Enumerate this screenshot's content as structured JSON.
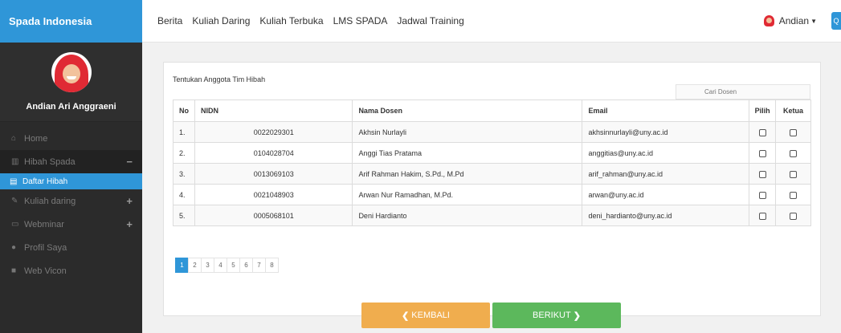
{
  "sidebar": {
    "brand": "Spada Indonesia",
    "profile_name": "Andian Ari Anggraeni",
    "items": [
      {
        "label": "Home",
        "icon": "home-icon"
      },
      {
        "label": "Hibah Spada",
        "icon": "book-icon",
        "toggle": "−"
      },
      {
        "label": "Daftar Hibah",
        "icon": "document-icon"
      },
      {
        "label": "Kuliah daring",
        "icon": "edit-icon",
        "toggle": "+"
      },
      {
        "label": "Webminar",
        "icon": "monitor-icon",
        "toggle": "+"
      },
      {
        "label": "Profil Saya",
        "icon": "user-icon"
      },
      {
        "label": "Web Vicon",
        "icon": "video-icon"
      }
    ]
  },
  "topbar": {
    "nav": [
      "Berita",
      "Kuliah Daring",
      "Kuliah Terbuka",
      "LMS SPADA",
      "Jadwal Training"
    ],
    "user_name": "Andian"
  },
  "panel": {
    "title": "Tentukan Anggota Tim Hibah",
    "search_placeholder": "Cari Dosen"
  },
  "table": {
    "headers": {
      "no": "No",
      "nidn": "NIDN",
      "nama": "Nama Dosen",
      "email": "Email",
      "pilih": "Pilih",
      "ketua": "Ketua"
    },
    "rows": [
      {
        "no": "1.",
        "nidn": "0022029301",
        "nama": "Akhsin Nurlayli",
        "email": "akhsinnurlayli@uny.ac.id"
      },
      {
        "no": "2.",
        "nidn": "0104028704",
        "nama": "Anggi Tias Pratama",
        "email": "anggitias@uny.ac.id"
      },
      {
        "no": "3.",
        "nidn": "0013069103",
        "nama": "Arif Rahman Hakim, S.Pd., M.Pd",
        "email": "arif_rahman@uny.ac.id"
      },
      {
        "no": "4.",
        "nidn": "0021048903",
        "nama": "Arwan Nur Ramadhan, M.Pd.",
        "email": "arwan@uny.ac.id"
      },
      {
        "no": "5.",
        "nidn": "0005068101",
        "nama": "Deni Hardianto",
        "email": "deni_hardianto@uny.ac.id"
      }
    ]
  },
  "pagination": {
    "pages": [
      "1",
      "2",
      "3",
      "4",
      "5",
      "6",
      "7",
      "8"
    ],
    "current": "1"
  },
  "buttons": {
    "back": "KEMBALI",
    "next": "BERIKUT"
  },
  "colors": {
    "accent": "#2f96d8",
    "back_button": "#f0ad4e",
    "next_button": "#5cb85c"
  }
}
